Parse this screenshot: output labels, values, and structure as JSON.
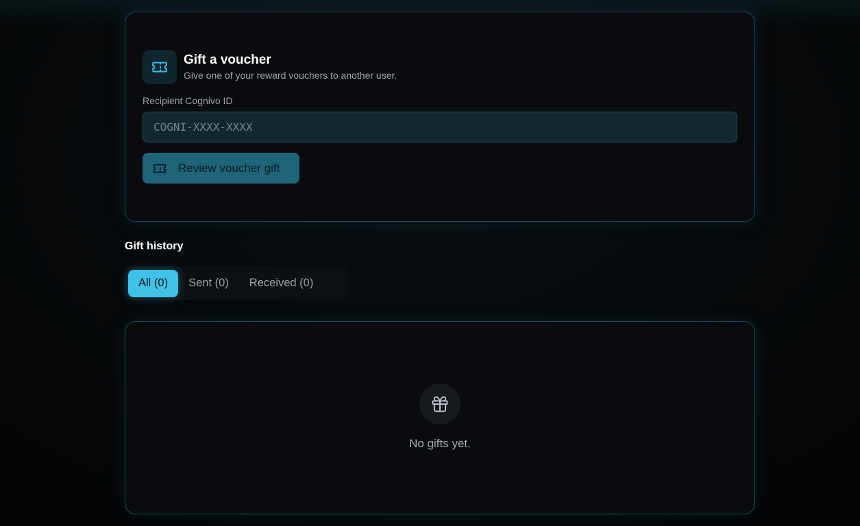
{
  "gift_voucher": {
    "icon": "ticket-icon",
    "title": "Gift a voucher",
    "subtitle": "Give one of your reward vouchers to another user.",
    "recipient_label": "Recipient Cognivo ID",
    "recipient_placeholder": "COGNI-XXXX-XXXX",
    "recipient_value": "",
    "review_button_label": "Review voucher gift"
  },
  "gift_history": {
    "title": "Gift history",
    "tabs": [
      {
        "label": "All (0)",
        "active": true
      },
      {
        "label": "Sent (0)",
        "active": false
      },
      {
        "label": "Received (0)",
        "active": false
      }
    ],
    "empty_icon": "gift-icon",
    "empty_text": "No gifts yet."
  },
  "colors": {
    "accent": "#3fc1e8",
    "button_bg": "#1f6478",
    "card_border": "#1b4c59",
    "background": "#050709"
  }
}
